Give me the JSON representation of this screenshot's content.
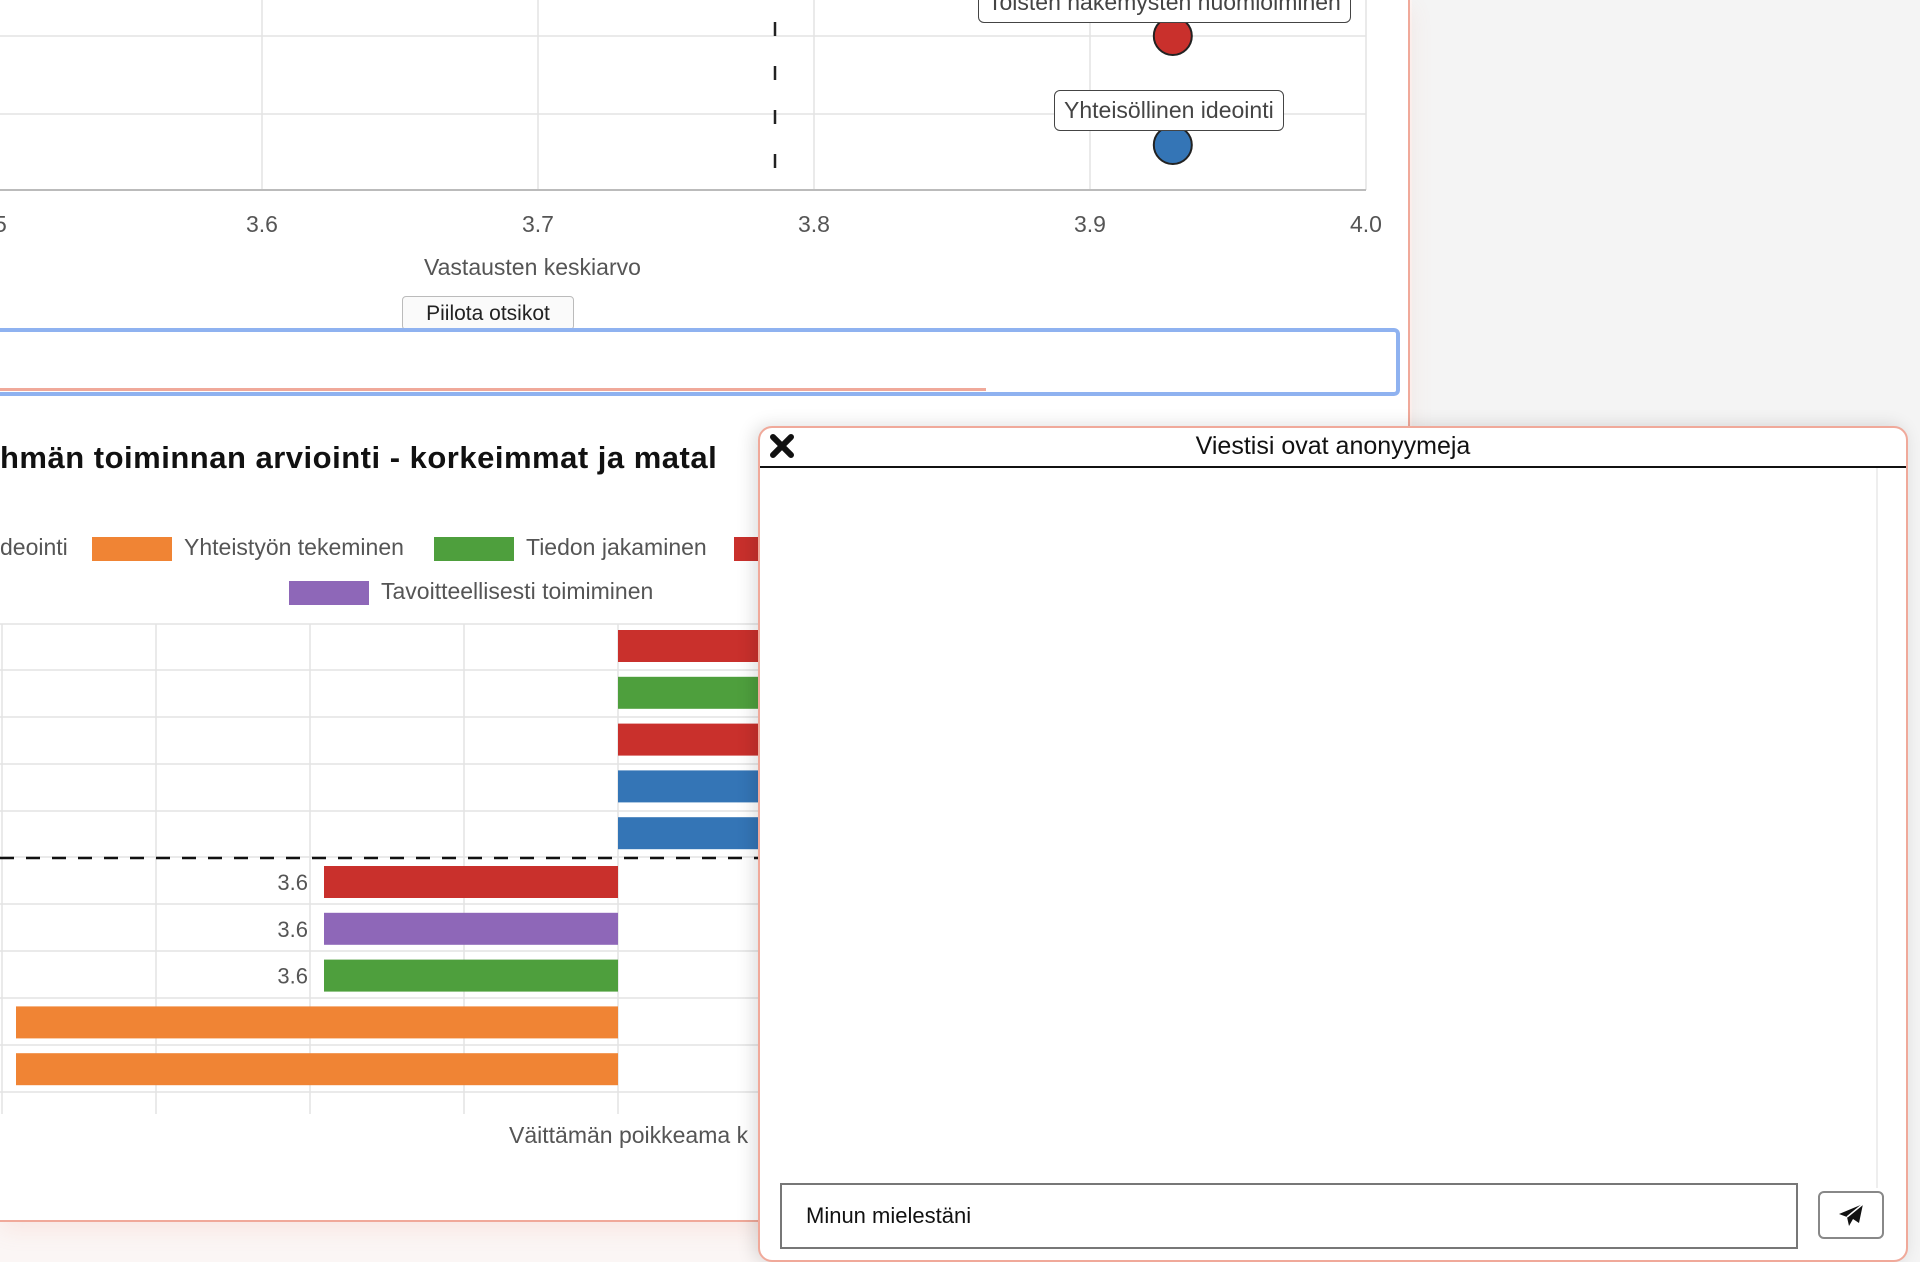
{
  "scatter": {
    "x_ticks": [
      "3.6",
      "3.7",
      "3.8",
      "3.9",
      "4.0"
    ],
    "x_label": "Vastausten keskiarvo",
    "points": [
      {
        "label": "Toisten näkemysten huomioiminen",
        "x": 3.93,
        "color": "#c9302c"
      },
      {
        "label": "Yhteisöllinen ideointi",
        "x": 3.93,
        "color": "#3475b6"
      }
    ],
    "mean_line_x": 3.785,
    "hide_button": "Piilota otsikot"
  },
  "bar_section": {
    "title": "hmän toiminnan arviointi - korkeimmat ja matal",
    "legend": [
      {
        "label": "deointi",
        "color": "#3475b6"
      },
      {
        "label": "Yhteistyön tekeminen",
        "color": "#f08434"
      },
      {
        "label": "Tiedon jakaminen",
        "color": "#4e9f3d"
      },
      {
        "label": "",
        "color": "#c9302c"
      },
      {
        "label": "Tavoitteellisesti toimiminen",
        "color": "#8e67b8"
      }
    ],
    "x_label": "Väittämän poikkeama k"
  },
  "chart_data": {
    "type": "bar",
    "orientation": "horizontal",
    "partial": true,
    "bars": [
      {
        "category_color": "red",
        "direction": "positive"
      },
      {
        "category_color": "green",
        "direction": "positive"
      },
      {
        "category_color": "red",
        "direction": "positive"
      },
      {
        "category_color": "blue",
        "direction": "positive"
      },
      {
        "category_color": "blue",
        "direction": "positive"
      },
      {
        "category_color": "red",
        "direction": "negative",
        "label": "3.6"
      },
      {
        "category_color": "purple",
        "direction": "negative",
        "label": "3.6"
      },
      {
        "category_color": "green",
        "direction": "negative",
        "label": "3.6"
      },
      {
        "category_color": "orange",
        "direction": "negative"
      },
      {
        "category_color": "orange",
        "direction": "negative"
      }
    ]
  },
  "chat": {
    "title": "Viestisi ovat anonyymeja",
    "input_value": "Minun mielestäni",
    "close_icon": "close-icon",
    "send_icon": "paper-plane-icon"
  }
}
